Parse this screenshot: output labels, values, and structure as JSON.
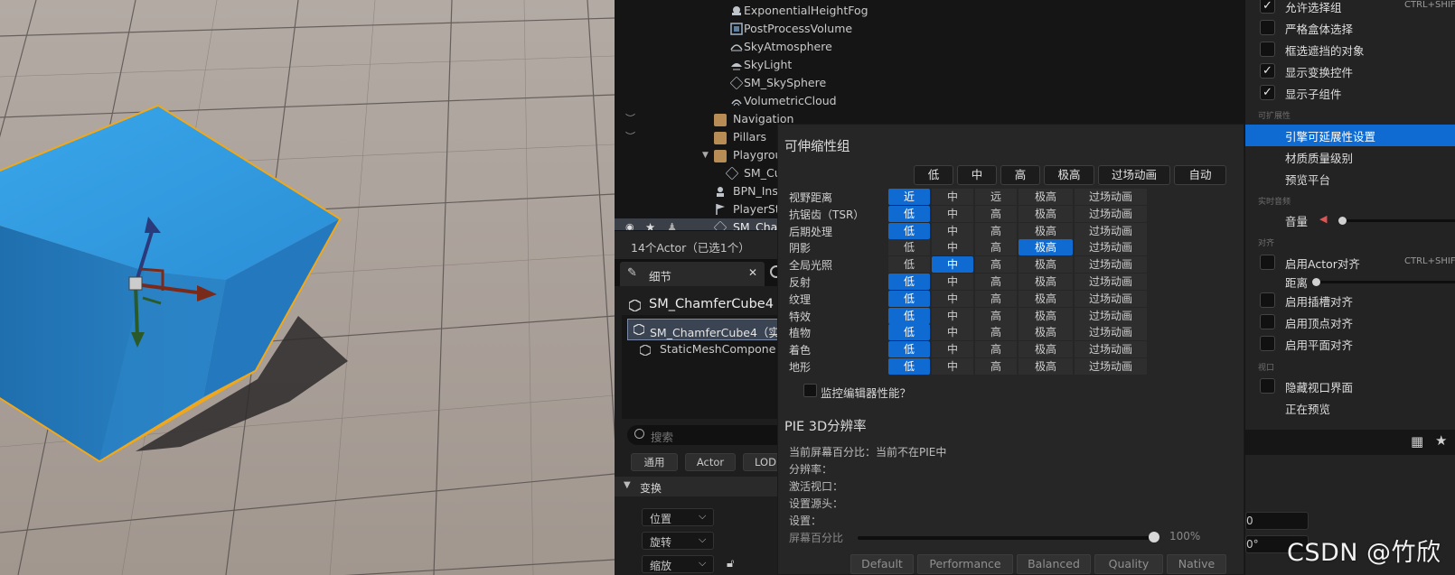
{
  "outliner": {
    "items": [
      {
        "label": "ExponentialHeightFog",
        "icon": "fog-icon"
      },
      {
        "label": "PostProcessVolume",
        "icon": "volume-icon"
      },
      {
        "label": "SkyAtmosphere",
        "icon": "atmosphere-icon"
      },
      {
        "label": "SkyLight",
        "icon": "skylight-icon"
      },
      {
        "label": "SM_SkySphere",
        "icon": "mesh-icon"
      },
      {
        "label": "VolumetricCloud",
        "icon": "cloud-icon"
      },
      {
        "label": "Navigation",
        "icon": "folder-icon"
      },
      {
        "label": "Pillars",
        "icon": "folder-icon"
      },
      {
        "label": "Playgrou",
        "icon": "folder-open-icon"
      },
      {
        "label": "SM_Cu",
        "icon": "mesh-icon"
      },
      {
        "label": "BPN_Ins",
        "icon": "blueprint-icon"
      },
      {
        "label": "PlayerSt",
        "icon": "player-start-icon"
      },
      {
        "label": "SM_Cha",
        "icon": "mesh-icon"
      }
    ]
  },
  "status": {
    "actor_count": "14个Actor（已选1个）"
  },
  "details": {
    "tab_label": "细节",
    "object_name": "SM_ChamferCube4",
    "components": {
      "root": "SM_ChamferCube4（实",
      "child": "StaticMeshCompone"
    },
    "search_placeholder": "搜索",
    "filters": [
      "通用",
      "Actor",
      "LOD"
    ],
    "section": "变换",
    "transform_fields": [
      "位置",
      "旋转",
      "缩放"
    ]
  },
  "scalability": {
    "title": "可伸缩性组",
    "header_buttons": [
      "低",
      "中",
      "高",
      "极高",
      "过场动画",
      "自动"
    ],
    "rows": [
      {
        "label": "视野距离",
        "options": [
          "近",
          "中",
          "远",
          "极高",
          "过场动画"
        ],
        "selected": 0
      },
      {
        "label": "抗锯齿（TSR）",
        "options": [
          "低",
          "中",
          "高",
          "极高",
          "过场动画"
        ],
        "selected": 0
      },
      {
        "label": "后期处理",
        "options": [
          "低",
          "中",
          "高",
          "极高",
          "过场动画"
        ],
        "selected": 0
      },
      {
        "label": "阴影",
        "options": [
          "低",
          "中",
          "高",
          "极高",
          "过场动画"
        ],
        "selected": 3
      },
      {
        "label": "全局光照",
        "options": [
          "低",
          "中",
          "高",
          "极高",
          "过场动画"
        ],
        "selected": 1
      },
      {
        "label": "反射",
        "options": [
          "低",
          "中",
          "高",
          "极高",
          "过场动画"
        ],
        "selected": 0
      },
      {
        "label": "纹理",
        "options": [
          "低",
          "中",
          "高",
          "极高",
          "过场动画"
        ],
        "selected": 0
      },
      {
        "label": "特效",
        "options": [
          "低",
          "中",
          "高",
          "极高",
          "过场动画"
        ],
        "selected": 0
      },
      {
        "label": "植物",
        "options": [
          "低",
          "中",
          "高",
          "极高",
          "过场动画"
        ],
        "selected": 0
      },
      {
        "label": "着色",
        "options": [
          "低",
          "中",
          "高",
          "极高",
          "过场动画"
        ],
        "selected": 0
      },
      {
        "label": "地形",
        "options": [
          "低",
          "中",
          "高",
          "极高",
          "过场动画"
        ],
        "selected": 0
      }
    ],
    "monitor_label": "监控编辑器性能？",
    "pie_title": "PIE 3D分辨率",
    "pie_lines": [
      "当前屏幕百分比：当前不在PIE中",
      "分辨率：",
      "激活视口：",
      "设置源头：",
      "设置："
    ],
    "screen_pct_label": "屏幕百分比",
    "screen_pct_value": "100%",
    "screen_pct_fraction": 1.0,
    "presets": [
      "Default",
      "Performance",
      "Balanced",
      "Quality",
      "Native"
    ]
  },
  "menu": {
    "items_top": [
      {
        "label": "允许选择组",
        "checked": true,
        "shortcut": "CTRL+SHIF"
      },
      {
        "label": "严格盒体选择",
        "checked": false
      },
      {
        "label": "框选遮挡的对象",
        "checked": false
      },
      {
        "label": "显示变换控件",
        "checked": true
      },
      {
        "label": "显示子组件",
        "checked": true
      }
    ],
    "section_scalability": "可扩展性",
    "scalability_items": [
      "引擎可延展性设置",
      "材质质量级别",
      "预览平台"
    ],
    "section_realtime_audio": "实时音频",
    "volume_label": "音量",
    "section_snap": "对齐",
    "snap_actor": {
      "label": "启用Actor对齐",
      "shortcut": "CTRL+SHIF"
    },
    "distance_label": "距离",
    "snap_items": [
      "启用插槽对齐",
      "启用顶点对齐",
      "启用平面对齐"
    ],
    "section_viewport": "视口",
    "hide_ui_label": "隐藏视口界面",
    "previewing_label": "正在预览",
    "inputs": [
      "0",
      "0°"
    ]
  },
  "watermark": "CSDN @竹欣",
  "colors": {
    "accent": "#0f6bd2",
    "selection_outline": "#f0a81a",
    "cube": "#2e92d8"
  }
}
